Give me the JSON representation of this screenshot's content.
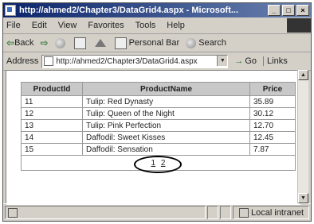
{
  "window": {
    "title": "http://ahmed2/Chapter3/DataGrid4.aspx - Microsoft...",
    "min_glyph": "_",
    "max_glyph": "□",
    "close_glyph": "×"
  },
  "menu": {
    "items": [
      "File",
      "Edit",
      "View",
      "Favorites",
      "Tools",
      "Help"
    ]
  },
  "toolbar": {
    "back_label": "Back",
    "back_glyph": "⇦",
    "forward_glyph": "⇨",
    "personal_bar_label": "Personal Bar",
    "search_label": "Search"
  },
  "address": {
    "label": "Address",
    "url": "http://ahmed2/Chapter3/DataGrid4.aspx",
    "go_label": "Go",
    "links_label": "Links"
  },
  "grid": {
    "columns": [
      "ProductId",
      "ProductName",
      "Price"
    ],
    "rows": [
      [
        "11",
        "Tulip: Red Dynasty",
        "35.89"
      ],
      [
        "12",
        "Tulip: Queen of the Night",
        "30.12"
      ],
      [
        "13",
        "Tulip: Pink Perfection",
        "12.70"
      ],
      [
        "14",
        "Daffodil: Sweet Kisses",
        "12.45"
      ],
      [
        "15",
        "Daffodil: Sensation",
        "7.87"
      ]
    ],
    "pager": [
      "1",
      "2"
    ]
  },
  "status": {
    "zone_label": "Local intranet"
  },
  "colors": {
    "titlebar": "#0a246a",
    "chrome": "#d4d0c8",
    "header_bg": "#c8c8c8"
  }
}
